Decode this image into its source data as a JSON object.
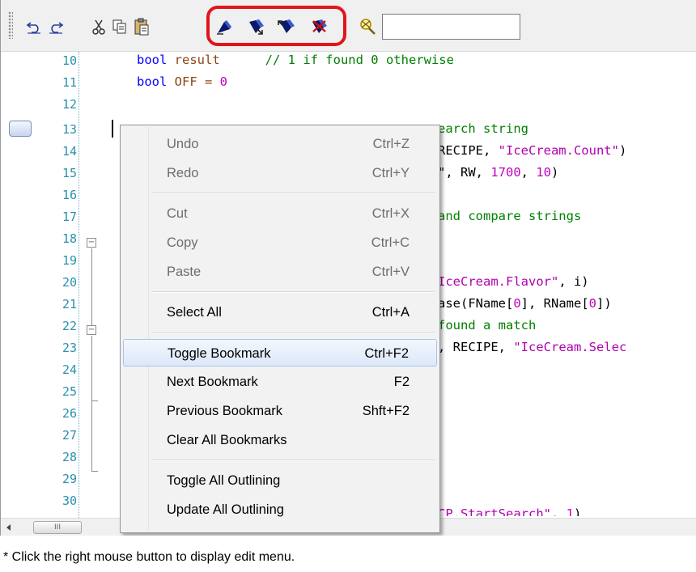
{
  "toolbar": {
    "icons": [
      "undo-icon",
      "redo-icon",
      "cut-icon",
      "copy-icon",
      "paste-icon",
      "toggle-bookmark-icon",
      "next-bookmark-icon",
      "previous-bookmark-icon",
      "clear-bookmarks-icon",
      "find-icon"
    ],
    "search_value": "",
    "highlight_color": "#e0161a"
  },
  "editor": {
    "line_numbers": [
      "10",
      "11",
      "12",
      "13",
      "14",
      "15",
      "16",
      "17",
      "18",
      "19",
      "20",
      "21",
      "22",
      "23",
      "24",
      "25",
      "26",
      "27",
      "28",
      "29",
      "30"
    ],
    "lines": {
      "l10_kw": "bool",
      "l10_var": " result",
      "l10_cmt": "// 1 if found 0 otherwise",
      "l11_kw": "bool",
      "l11_var": " OFF = ",
      "l11_num": "0",
      "l13_tail": "earch string",
      "l14_tail_a": "RECIPE, ",
      "l14_tail_str": "\"IceCream.Count\"",
      "l14_tail_b": ")",
      "l15_tail_a": "\", RW, ",
      "l15_n1": "1700",
      "l15_mid": ", ",
      "l15_n2": "10",
      "l15_end": ")",
      "l17_tail": "and compare strings",
      "l20_tail_str": "IceCream.Flavor\"",
      "l20_tail_b": ", i)",
      "l21_tail_a": "ase(FName[",
      "l21_n1": "0",
      "l21_mid": "], RName[",
      "l21_n2": "0",
      "l21_end": "])",
      "l22_tail": "found a match",
      "l23_tail_a": ", RECIPE, ",
      "l23_tail_str": "\"IceCream.Selec",
      "l30_tail_str": "CP.StartSearch\"",
      "l30_tail_b": ", ",
      "l30_n": "1",
      "l30_end": ")"
    }
  },
  "context_menu": {
    "items": [
      {
        "label": "Undo",
        "shortcut": "Ctrl+Z",
        "enabled": false
      },
      {
        "label": "Redo",
        "shortcut": "Ctrl+Y",
        "enabled": false
      },
      {
        "label": "Cut",
        "shortcut": "Ctrl+X",
        "enabled": false
      },
      {
        "label": "Copy",
        "shortcut": "Ctrl+C",
        "enabled": false
      },
      {
        "label": "Paste",
        "shortcut": "Ctrl+V",
        "enabled": false
      },
      {
        "label": "Select All",
        "shortcut": "Ctrl+A",
        "enabled": true
      },
      {
        "label": "Toggle Bookmark",
        "shortcut": "Ctrl+F2",
        "enabled": true,
        "hovered": true
      },
      {
        "label": "Next Bookmark",
        "shortcut": "F2",
        "enabled": true
      },
      {
        "label": "Previous Bookmark",
        "shortcut": "Shft+F2",
        "enabled": true
      },
      {
        "label": "Clear All Bookmarks",
        "shortcut": "",
        "enabled": true
      },
      {
        "label": "Toggle All Outlining",
        "shortcut": "",
        "enabled": true
      },
      {
        "label": "Update All Outlining",
        "shortcut": "",
        "enabled": true
      }
    ]
  },
  "scrollbar": {
    "thumb_grip": "III"
  },
  "caption": "* Click the right mouse button to display edit menu."
}
